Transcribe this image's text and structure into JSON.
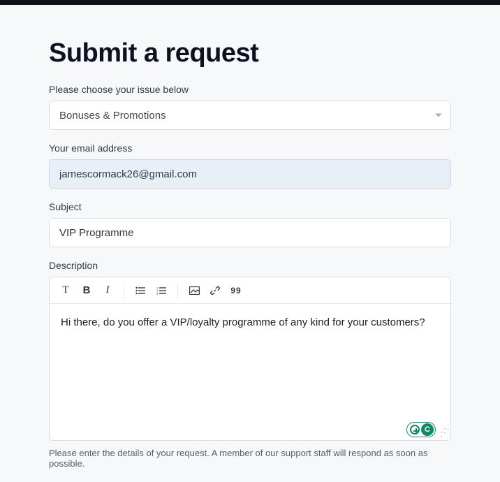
{
  "page": {
    "title": "Submit a request"
  },
  "form": {
    "issue_label": "Please choose your issue below",
    "issue_selected": "Bonuses & Promotions",
    "email_label": "Your email address",
    "email_value": "jamescormack26@gmail.com",
    "subject_label": "Subject",
    "subject_value": "VIP Programme",
    "description_label": "Description",
    "description_value": "Hi there, do you offer a VIP/loyalty programme of any kind for your customers?",
    "description_helper": "Please enter the details of your request. A member of our support staff will respond as soon as possible."
  },
  "widget": {
    "letter": "C"
  }
}
